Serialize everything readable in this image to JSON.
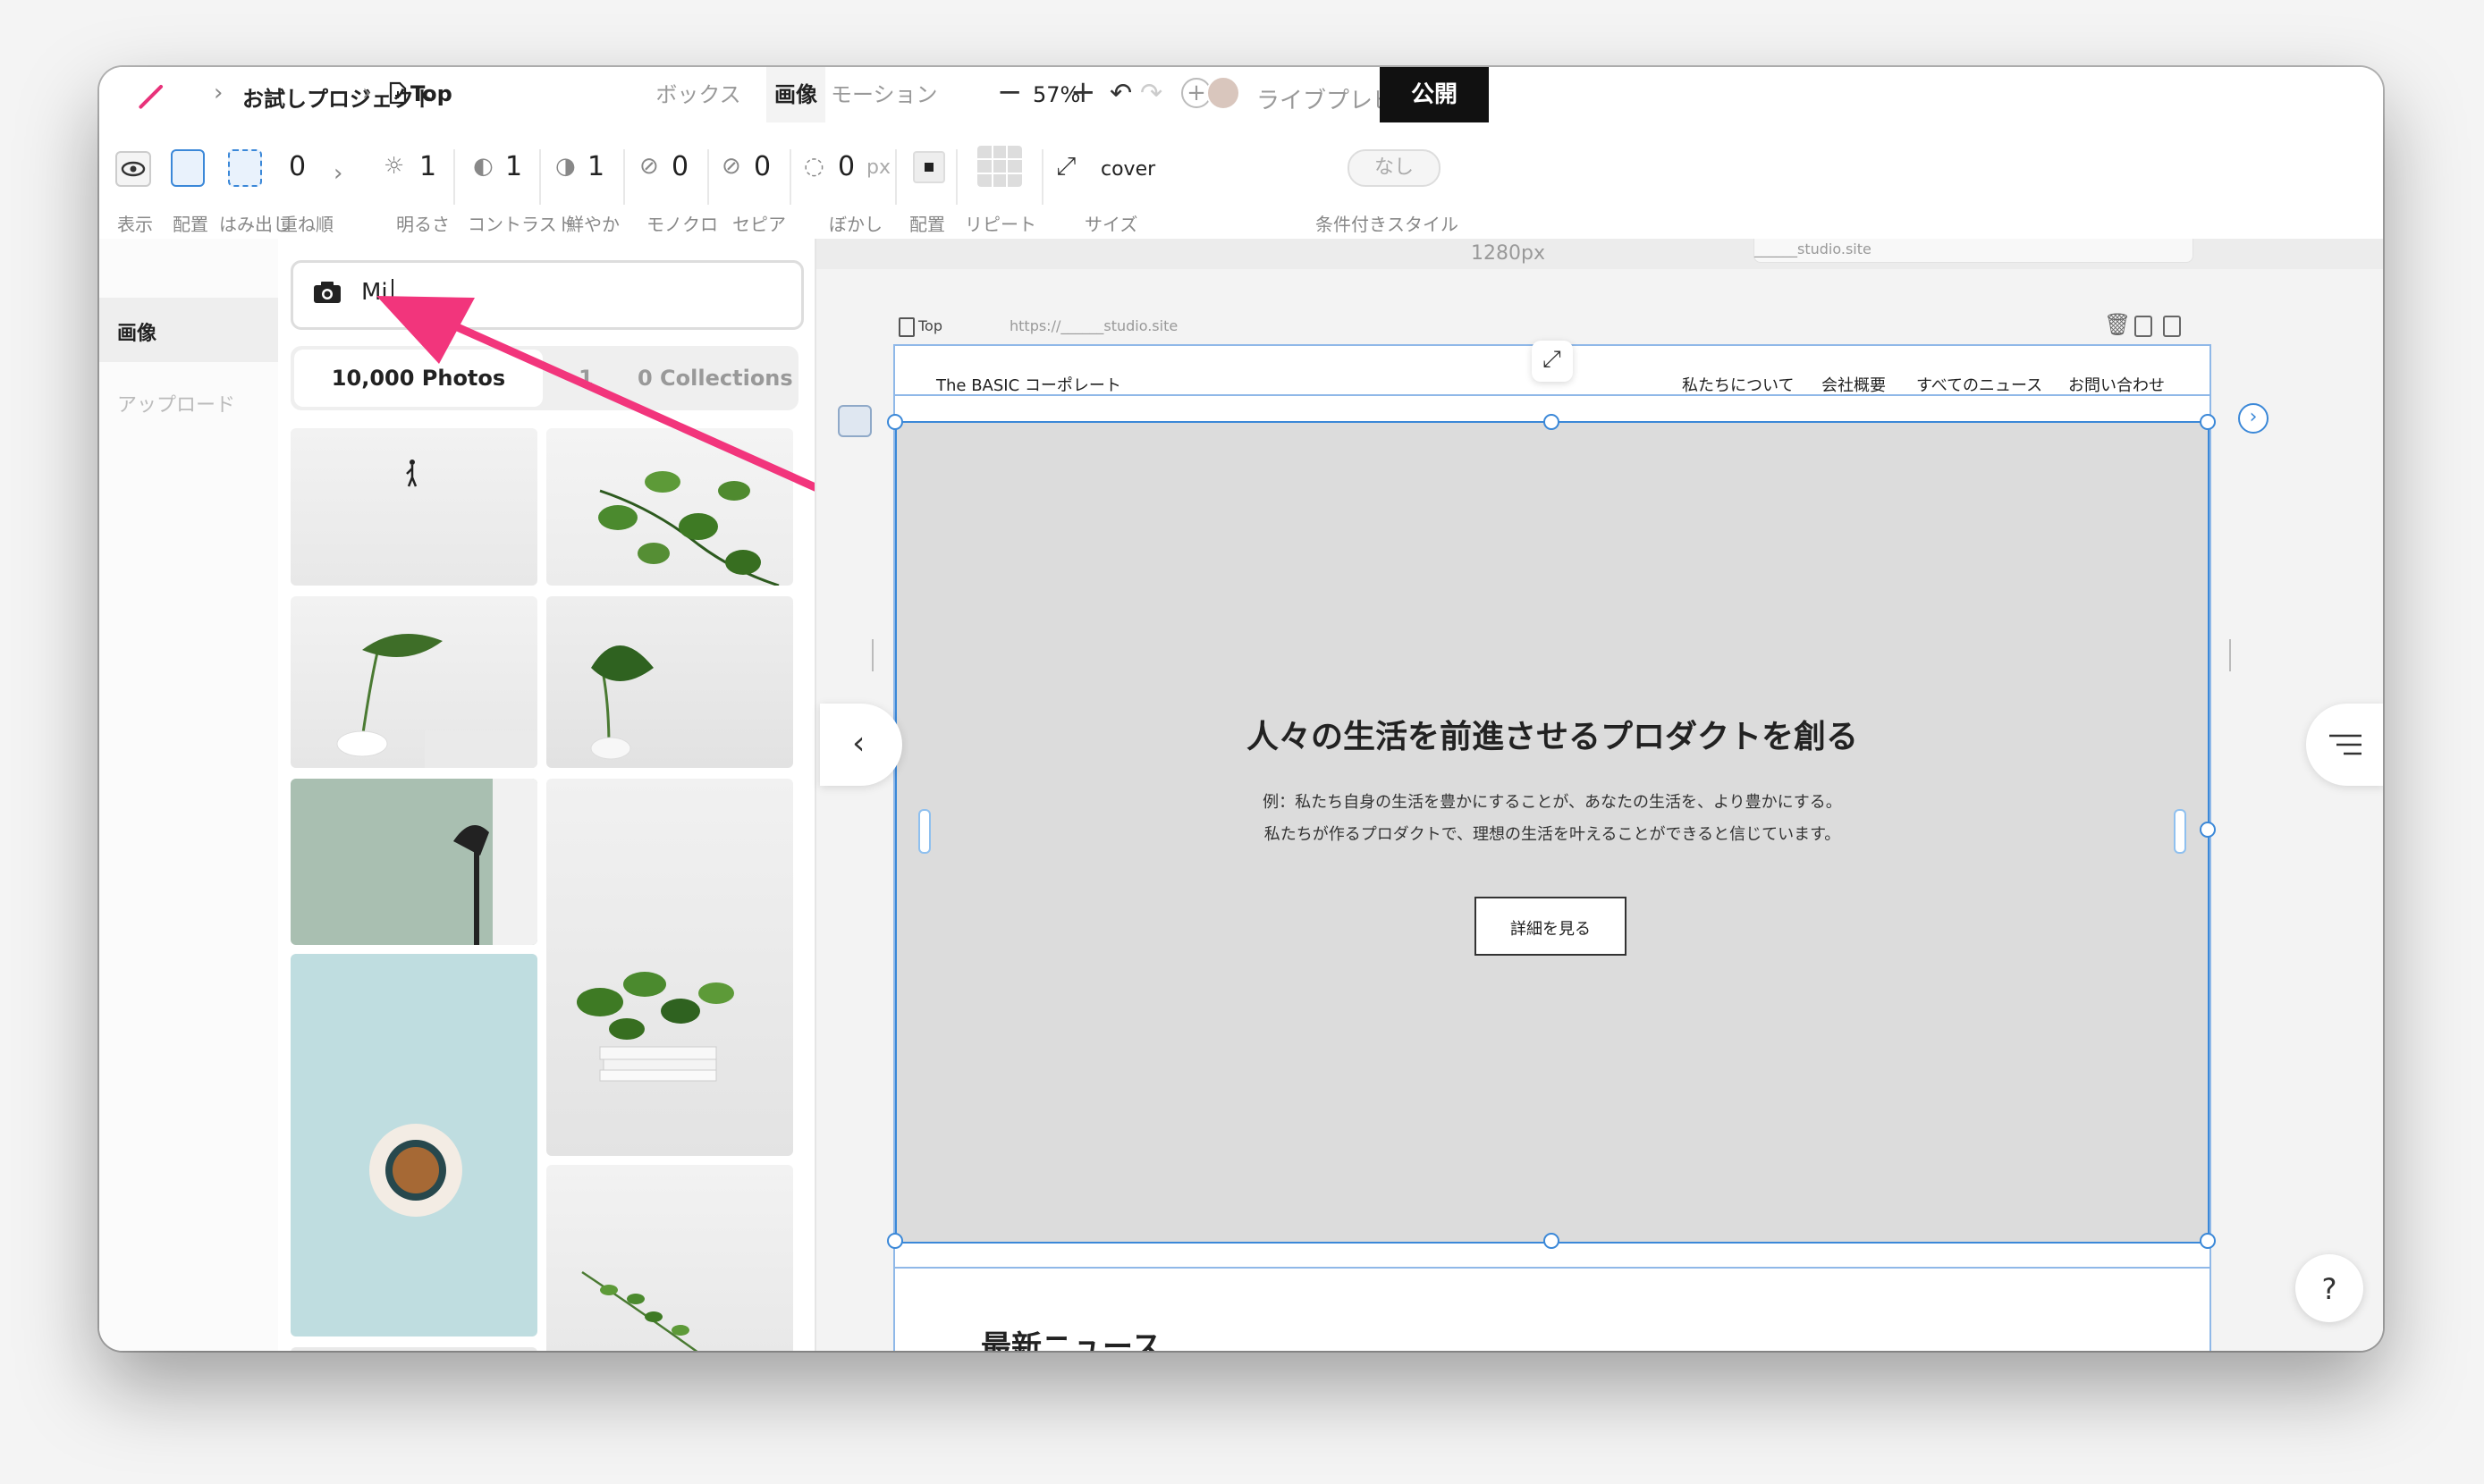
{
  "breadcrumb": {
    "project": "お試しプロジェクト",
    "page": "Top"
  },
  "tabs": [
    "ボックス",
    "画像",
    "モーション"
  ],
  "active_tab": "画像",
  "zoom": "57%",
  "live_preview_label": "ライブプレビュー",
  "publish_label": "公開",
  "toolbar": {
    "display_label": "表示",
    "layout_label": "配置",
    "overflow_label": "はみ出し",
    "zindex": {
      "value": "0",
      "label": "重ね順"
    },
    "brightness": {
      "value": "1",
      "label": "明るさ"
    },
    "contrast": {
      "value": "1",
      "label": "コントラスト"
    },
    "saturate": {
      "value": "1",
      "label": "鮮やか"
    },
    "grayscale": {
      "value": "0",
      "label": "モノクロ"
    },
    "sepia": {
      "value": "0",
      "label": "セピア"
    },
    "blur": {
      "value": "0",
      "unit": "px",
      "label": "ぼかし"
    },
    "position_label": "配置",
    "repeat_label": "リピート",
    "size": {
      "value": "cover",
      "label": "サイズ"
    },
    "conditional": {
      "value": "なし",
      "label": "条件付きスタイル"
    }
  },
  "rail": {
    "images_label": "画像",
    "upload_label": "アップロード"
  },
  "search": {
    "value": "Mi"
  },
  "panel_tabs": {
    "photos": "10,000 Photos",
    "collections_prefix": "1",
    "collections_suffix": "0 Collections"
  },
  "canvas": {
    "width_label": "1280px",
    "domain_top": "______studio.site",
    "page_label": "Top",
    "url": "https://______studio.site",
    "site": {
      "logo": "The BASIC コーポレート",
      "nav": [
        "私たちについて",
        "会社概要",
        "すべてのニュース",
        "お問い合わせ"
      ],
      "hero_title": "人々の生活を前進させるプロダクトを創る",
      "hero_line1": "例：私たち自身の生活を豊かにすることが、あなたの生活を、より豊かにする。",
      "hero_line2": "私たちが作るプロダクトで、理想の生活を叶えることができると信じています。",
      "hero_button": "詳細を見る",
      "news_heading": "最新ニュース"
    }
  },
  "help_label": "?",
  "colors": {
    "accent": "#e8327a",
    "selection": "#3b88d8",
    "publish_bg": "#111111",
    "hero_bg": "#dcdcdc"
  }
}
